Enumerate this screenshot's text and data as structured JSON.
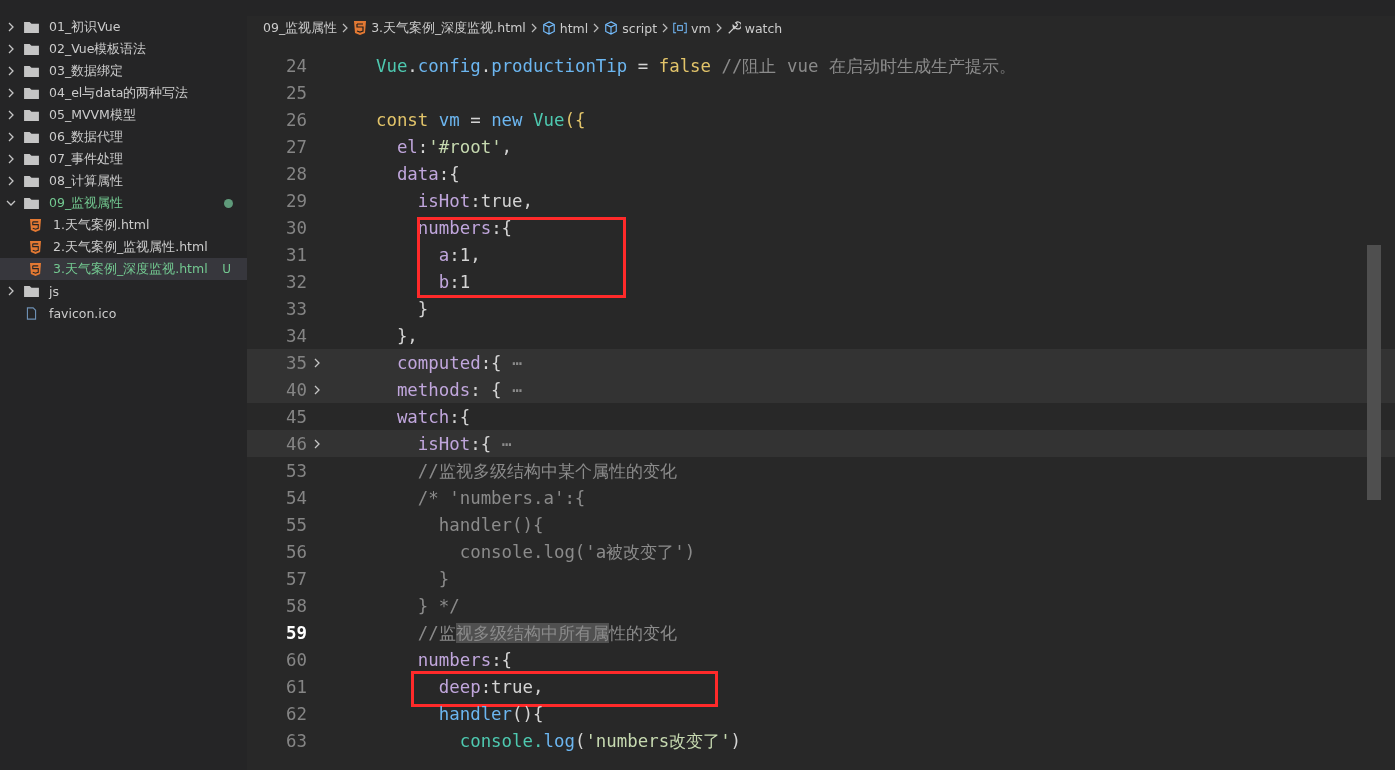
{
  "explorer": {
    "items": [
      {
        "kind": "folder",
        "label": "01_初识Vue",
        "expanded": false,
        "selected": false
      },
      {
        "kind": "folder",
        "label": "02_Vue模板语法",
        "expanded": false,
        "selected": false
      },
      {
        "kind": "folder",
        "label": "03_数据绑定",
        "expanded": false,
        "selected": false
      },
      {
        "kind": "folder",
        "label": "04_el与data的两种写法",
        "expanded": false,
        "selected": false
      },
      {
        "kind": "folder",
        "label": "05_MVVM模型",
        "expanded": false,
        "selected": false
      },
      {
        "kind": "folder",
        "label": "06_数据代理",
        "expanded": false,
        "selected": false
      },
      {
        "kind": "folder",
        "label": "07_事件处理",
        "expanded": false,
        "selected": false
      },
      {
        "kind": "folder",
        "label": "08_计算属性",
        "expanded": false,
        "selected": false
      },
      {
        "kind": "folder",
        "label": "09_监视属性",
        "expanded": true,
        "selected": false,
        "modified": true,
        "children": [
          {
            "kind": "html",
            "label": "1.天气案例.html",
            "selected": false
          },
          {
            "kind": "html",
            "label": "2.天气案例_监视属性.html",
            "selected": false
          },
          {
            "kind": "html",
            "label": "3.天气案例_深度监视.html",
            "selected": true,
            "badge": "U"
          }
        ]
      },
      {
        "kind": "folder",
        "label": "js",
        "expanded": false,
        "selected": false
      },
      {
        "kind": "file",
        "label": "favicon.ico",
        "selected": false
      }
    ]
  },
  "breadcrumb": [
    {
      "kind": "folder",
      "label": "09_监视属性"
    },
    {
      "kind": "html",
      "label": "3.天气案例_深度监视.html"
    },
    {
      "kind": "element",
      "label": "html"
    },
    {
      "kind": "element",
      "label": "script"
    },
    {
      "kind": "variable",
      "label": "vm"
    },
    {
      "kind": "property",
      "label": "watch"
    }
  ],
  "code": [
    {
      "number": "24",
      "tokens": [
        {
          "kind": "class",
          "text": "  Vue"
        },
        {
          "kind": "plain",
          "text": "."
        },
        {
          "kind": "ident",
          "text": "config"
        },
        {
          "kind": "plain",
          "text": "."
        },
        {
          "kind": "ident",
          "text": "productionTip"
        },
        {
          "kind": "plain",
          "text": " = "
        },
        {
          "kind": "keyword",
          "text": "false"
        },
        {
          "kind": "comment",
          "text": " //阻止 vue 在启动时生成生产提示。"
        }
      ]
    },
    {
      "number": "25"
    },
    {
      "number": "26",
      "tokens": [
        {
          "kind": "keyword",
          "text": "  const"
        },
        {
          "kind": "ident",
          "text": " vm"
        },
        {
          "kind": "plain",
          "text": " = "
        },
        {
          "kind": "ident",
          "text": "new"
        },
        {
          "kind": "class",
          "text": " Vue"
        },
        {
          "kind": "keyword",
          "text": "({"
        }
      ]
    },
    {
      "number": "27",
      "tokens": [
        {
          "kind": "prop",
          "text": "    el"
        },
        {
          "kind": "plain",
          "text": ":"
        },
        {
          "kind": "string",
          "text": "'#root'"
        },
        {
          "kind": "plain",
          "text": ","
        }
      ]
    },
    {
      "number": "28",
      "tokens": [
        {
          "kind": "prop",
          "text": "    data"
        },
        {
          "kind": "plain",
          "text": ":{"
        }
      ]
    },
    {
      "number": "29",
      "tokens": [
        {
          "kind": "prop",
          "text": "      isHot"
        },
        {
          "kind": "plain",
          "text": ":true,"
        }
      ]
    },
    {
      "number": "30",
      "boxed": true,
      "tokens": [
        {
          "kind": "prop",
          "text": "      numbers"
        },
        {
          "kind": "plain",
          "text": ":{"
        }
      ]
    },
    {
      "number": "31",
      "boxed": true,
      "tokens": [
        {
          "kind": "prop",
          "text": "        a"
        },
        {
          "kind": "plain",
          "text": ":1,"
        }
      ]
    },
    {
      "number": "32",
      "boxed": true,
      "tokens": [
        {
          "kind": "prop",
          "text": "        b"
        },
        {
          "kind": "plain",
          "text": ":1"
        }
      ]
    },
    {
      "number": "33",
      "tokens": [
        {
          "kind": "plain",
          "text": "      }"
        }
      ]
    },
    {
      "number": "34",
      "tokens": [
        {
          "kind": "plain",
          "text": "    },"
        }
      ]
    },
    {
      "number": "35",
      "folded": true,
      "tokens": [
        {
          "kind": "prop",
          "text": "    computed"
        },
        {
          "kind": "plain",
          "text": ":{ "
        },
        {
          "kind": "comment",
          "text": "⋯"
        }
      ]
    },
    {
      "number": "40",
      "folded": true,
      "tokens": [
        {
          "kind": "prop",
          "text": "    methods"
        },
        {
          "kind": "plain",
          "text": ": { "
        },
        {
          "kind": "comment",
          "text": "⋯"
        }
      ]
    },
    {
      "number": "45",
      "tokens": [
        {
          "kind": "prop",
          "text": "    watch"
        },
        {
          "kind": "plain",
          "text": ":{"
        }
      ]
    },
    {
      "number": "46",
      "folded": true,
      "tokens": [
        {
          "kind": "prop",
          "text": "      isHot"
        },
        {
          "kind": "plain",
          "text": ":{ "
        },
        {
          "kind": "comment",
          "text": "⋯"
        }
      ]
    },
    {
      "number": "53",
      "tokens": [
        {
          "kind": "comment",
          "text": "      //监视多级结构中某个属性的变化"
        }
      ]
    },
    {
      "number": "54",
      "tokens": [
        {
          "kind": "comment",
          "text": "      /* 'numbers.a':{"
        }
      ]
    },
    {
      "number": "55",
      "tokens": [
        {
          "kind": "comment",
          "text": "        handler(){"
        }
      ]
    },
    {
      "number": "56",
      "tokens": [
        {
          "kind": "comment",
          "text": "          console.log('a被改变了')"
        }
      ]
    },
    {
      "number": "57",
      "tokens": [
        {
          "kind": "comment",
          "text": "        }"
        }
      ]
    },
    {
      "number": "58",
      "tokens": [
        {
          "kind": "comment",
          "text": "      } */"
        }
      ]
    },
    {
      "number": "59",
      "current": true,
      "tokens": [
        {
          "kind": "comment",
          "text": "      //监"
        },
        {
          "kind": "selection",
          "text": "视多级结构中所有属"
        },
        {
          "kind": "comment",
          "text": "性的变化"
        }
      ]
    },
    {
      "number": "60",
      "tokens": [
        {
          "kind": "prop",
          "text": "      numbers"
        },
        {
          "kind": "plain",
          "text": ":{"
        }
      ]
    },
    {
      "number": "61",
      "boxed": true,
      "tokens": [
        {
          "kind": "prop",
          "text": "        deep"
        },
        {
          "kind": "plain",
          "text": ":true,"
        }
      ]
    },
    {
      "number": "62",
      "tokens": [
        {
          "kind": "ident",
          "text": "        handler"
        },
        {
          "kind": "plain",
          "text": "(){"
        }
      ]
    },
    {
      "number": "63",
      "tokens": [
        {
          "kind": "class",
          "text": "          console."
        },
        {
          "kind": "ident",
          "text": "log"
        },
        {
          "kind": "plain",
          "text": "("
        },
        {
          "kind": "string",
          "text": "'numbers改变了'"
        },
        {
          "kind": "plain",
          "text": ")"
        }
      ]
    }
  ]
}
